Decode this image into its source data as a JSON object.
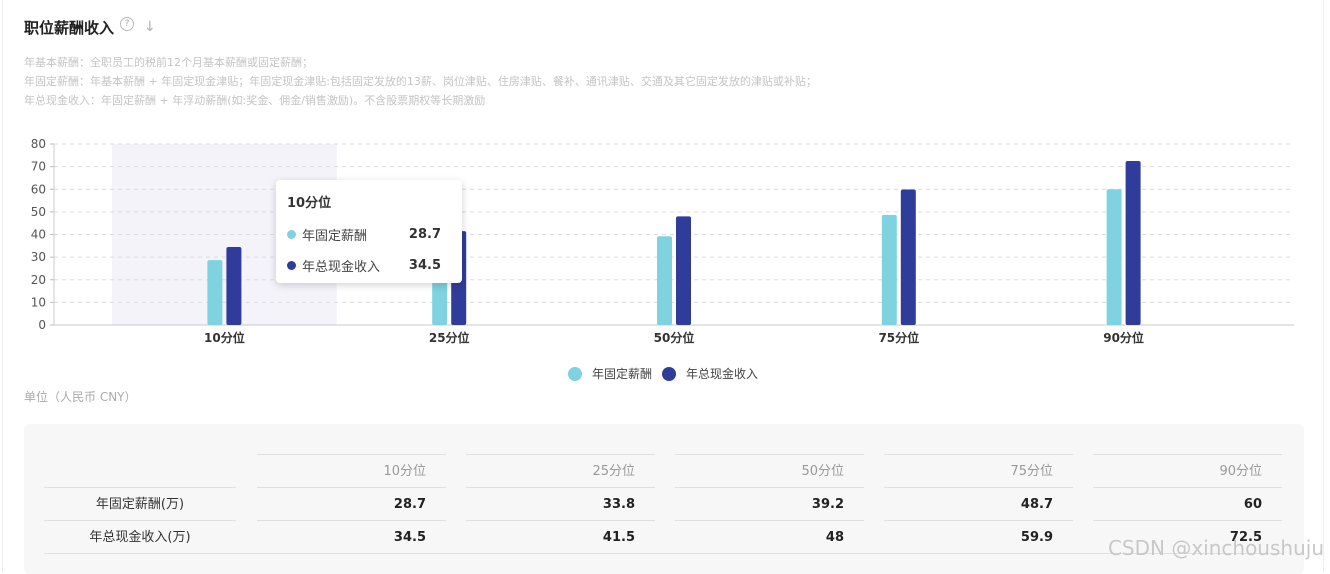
{
  "header": {
    "title": "职位薪酬收入",
    "help_icon": "question-circle-icon",
    "help_glyph": "?",
    "download_icon": "arrow-down-icon",
    "download_glyph": "↓"
  },
  "description": {
    "lines": [
      "年基本薪酬：全职员工的税前12个月基本薪酬或固定薪酬；",
      "年固定薪酬：年基本薪酬 + 年固定现金津贴；年固定现金津贴:包括固定发放的13薪、岗位津贴、住房津贴、餐补、通讯津贴、交通及其它固定发放的津贴或补贴；",
      "年总现金收入：年固定薪酬 + 年浮动薪酬(如:奖金、佣金/销售激励)。不含股票期权等长期激励"
    ]
  },
  "chart_data": {
    "type": "bar",
    "categories": [
      "10分位",
      "25分位",
      "50分位",
      "75分位",
      "90分位"
    ],
    "series": [
      {
        "name": "年固定薪酬",
        "values": [
          28.7,
          33.8,
          39.2,
          48.7,
          60
        ],
        "color": "#7fd2df"
      },
      {
        "name": "年总现金收入",
        "values": [
          34.5,
          41.5,
          48,
          59.9,
          72.5
        ],
        "color": "#303c99"
      }
    ],
    "ylim": [
      0,
      80
    ],
    "yticks": [
      0,
      10,
      20,
      30,
      40,
      50,
      60,
      70,
      80
    ],
    "grid": true,
    "legend": "bottom",
    "highlighted_category": "10分位",
    "highlight_color": "#f4f3fa",
    "tooltip": {
      "title": "10分位",
      "rows": [
        {
          "name": "年固定薪酬",
          "value": "28.7",
          "color": "#7fd2df"
        },
        {
          "name": "年总现金收入",
          "value": "34.5",
          "color": "#303c99"
        }
      ]
    }
  },
  "unit": "单位（人民币 CNY）",
  "table": {
    "headers": [
      "10分位",
      "25分位",
      "50分位",
      "75分位",
      "90分位"
    ],
    "rows": [
      {
        "label": "年固定薪酬(万)",
        "values": [
          "28.7",
          "33.8",
          "39.2",
          "48.7",
          "60"
        ]
      },
      {
        "label": "年总现金收入(万)",
        "values": [
          "34.5",
          "41.5",
          "48",
          "59.9",
          "72.5"
        ]
      }
    ]
  },
  "watermark": "CSDN @xinchoushuju"
}
